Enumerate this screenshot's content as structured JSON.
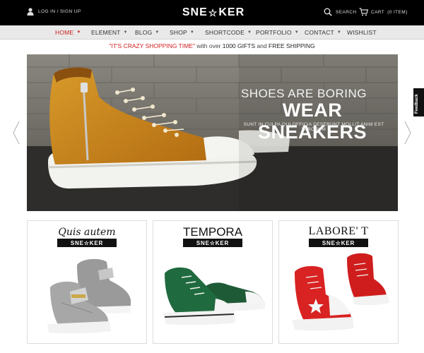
{
  "header": {
    "login_label": "LOG IN / SIGN UP",
    "logo": {
      "left": "SNE",
      "right": "KER"
    },
    "search_label": "SEARCH",
    "cart_label": "CART",
    "cart_count": "(0 ITEM)"
  },
  "nav": {
    "items": [
      {
        "label": "HOME",
        "active": true,
        "has_caret": true
      },
      {
        "label": "ELEMENT",
        "has_caret": true
      },
      {
        "label": "BLOG",
        "has_caret": true
      },
      {
        "label": "SHOP",
        "has_caret": true
      },
      {
        "label": "SHORTCODE",
        "has_caret": true
      },
      {
        "label": "PORTFOLIO",
        "has_caret": true
      },
      {
        "label": "CONTACT",
        "has_caret": true
      },
      {
        "label": "WISHLIST",
        "has_caret": false
      }
    ]
  },
  "promo": {
    "highlight": "\"IT'S CRAZY SHOPPING TIME\"",
    "with_text": "with over",
    "gifts": "1000 GIFTS",
    "and_text": "and",
    "shipping": "FREE SHIPPING"
  },
  "hero": {
    "subtitle": "SHOES ARE BORING",
    "title": "WEAR SNEAKERS",
    "tagline": "SUNT IN CULPA QUI OFFICIA DESERUNT MOLLIT ANIM EST LABORUM"
  },
  "feedback_label": "Feedback",
  "cards": [
    {
      "title": "Quis autem",
      "badge": {
        "left": "SNE",
        "right": "KER"
      }
    },
    {
      "title": "TEMPORA",
      "badge": {
        "left": "SNE",
        "right": "KER"
      }
    },
    {
      "title": "LABORE' T",
      "badge": {
        "left": "SNE",
        "right": "KER"
      }
    }
  ],
  "colors": {
    "accent": "#cc1f1f",
    "topbar": "#000000",
    "nav_bg": "#e9e9e9"
  }
}
